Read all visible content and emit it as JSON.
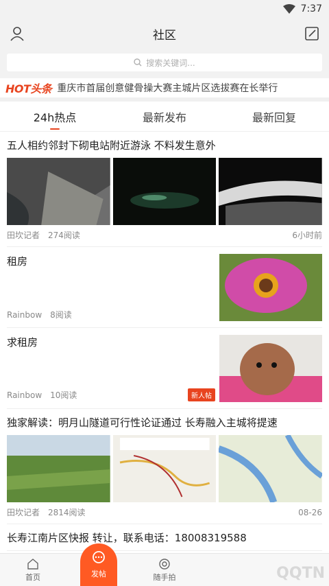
{
  "status": {
    "time": "7:37"
  },
  "header": {
    "title": "社区"
  },
  "search": {
    "placeholder": "搜索关键词..."
  },
  "hot": {
    "logo": "HOT头条",
    "text": "重庆市首届创意健骨操大赛主城片区选拔赛在长举行"
  },
  "tabs": [
    {
      "label": "24h热点"
    },
    {
      "label": "最新发布"
    },
    {
      "label": "最新回复"
    }
  ],
  "posts": [
    {
      "title": "五人相约邻封下砌电站附近游泳 不料发生意外",
      "author": "田坎记者",
      "reads": "274阅读",
      "time": "6小时前"
    },
    {
      "title": "租房",
      "author": "Rainbow",
      "reads": "8阅读"
    },
    {
      "title": "求租房",
      "author": "Rainbow",
      "reads": "10阅读",
      "badge": "新人帖"
    },
    {
      "title": "独家解读：明月山隧道可行性论证通过 长寿融入主城将提速",
      "author": "田坎记者",
      "reads": "2814阅读",
      "time": "08-26"
    },
    {
      "title": "长寿江南片区快报 转让，联系电话：18008319588"
    }
  ],
  "nav": [
    {
      "label": "首页"
    },
    {
      "label": "发帖"
    },
    {
      "label": "随手拍"
    }
  ],
  "watermark": "QQTN"
}
